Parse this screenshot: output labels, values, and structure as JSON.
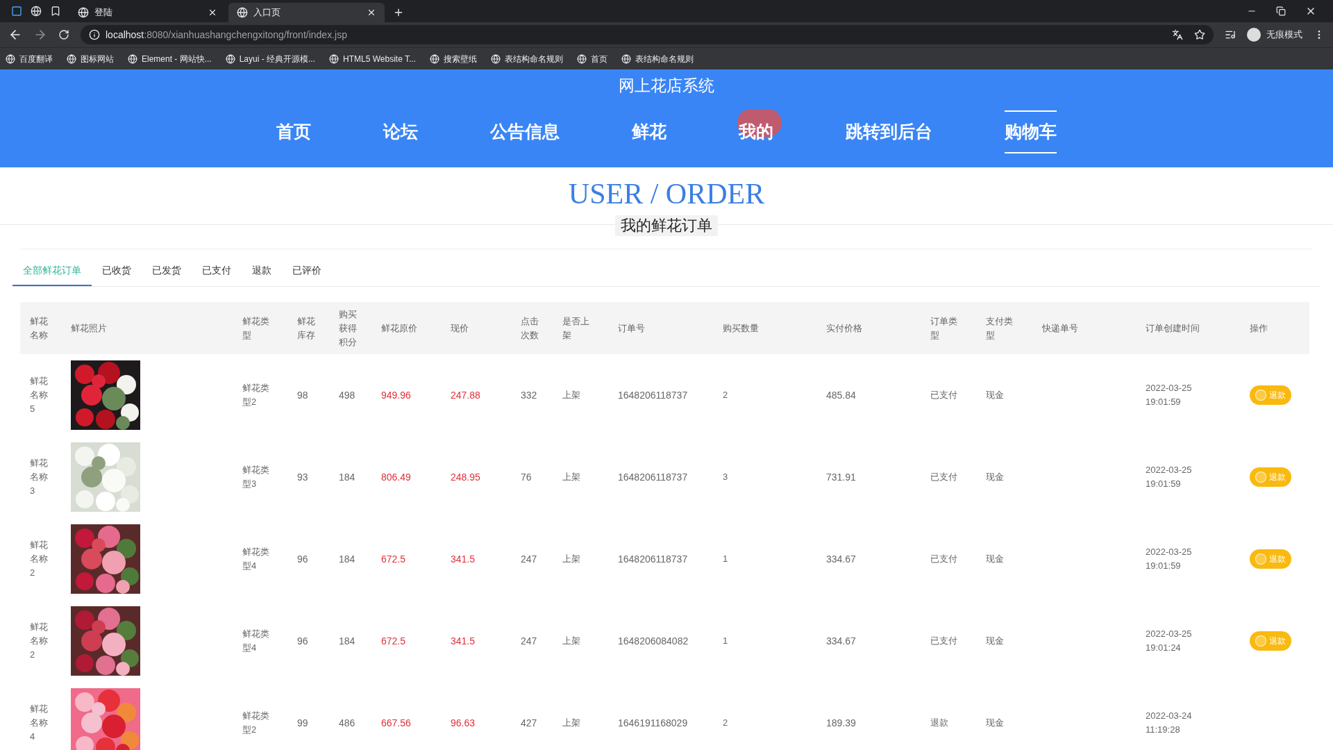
{
  "browser": {
    "tabs": [
      {
        "title": "登陆",
        "selected": false
      },
      {
        "title": "入口页",
        "selected": true
      }
    ],
    "url_host": "localhost",
    "url_path": ":8080/xianhuashangchengxitong/front/index.jsp",
    "profile": "无痕模式",
    "bookmarks": [
      "百度翻译",
      "图标网站",
      "Element - 网站快...",
      "Layui - 经典开源模...",
      "HTML5 Website T...",
      "搜索壁纸",
      "表结构命名规则",
      "首页",
      "表结构命名规则"
    ]
  },
  "site": {
    "title": "网上花店系统",
    "nav": [
      {
        "label": "首页",
        "selected": false,
        "hovered": false
      },
      {
        "label": "论坛",
        "selected": false,
        "hovered": false
      },
      {
        "label": "公告信息",
        "selected": false,
        "hovered": false
      },
      {
        "label": "鲜花",
        "selected": false,
        "hovered": false
      },
      {
        "label": "我的",
        "selected": false,
        "hovered": true
      },
      {
        "label": "跳转到后台",
        "selected": false,
        "hovered": false
      },
      {
        "label": "购物车",
        "selected": true,
        "hovered": false
      }
    ]
  },
  "heading": "USER / ORDER",
  "subheading": "我的鲜花订单",
  "filter_tabs": [
    {
      "label": "全部鲜花订单",
      "selected": true
    },
    {
      "label": "已收货",
      "selected": false
    },
    {
      "label": "已发货",
      "selected": false
    },
    {
      "label": "已支付",
      "selected": false
    },
    {
      "label": "退款",
      "selected": false
    },
    {
      "label": "已评价",
      "selected": false
    }
  ],
  "table": {
    "columns": [
      "鲜花名称",
      "鲜花照片",
      "鲜花类型",
      "鲜花库存",
      "购买获得积分",
      "鲜花原价",
      "现价",
      "点击次数",
      "是否上架",
      "订单号",
      "购买数量",
      "实付价格",
      "订单类型",
      "支付类型",
      "快递单号",
      "订单创建时间",
      "操作"
    ],
    "rows": [
      {
        "name": "鲜花名称5",
        "type": "鲜花类型2",
        "stock": "98",
        "points": "498",
        "original_price": "949.96",
        "price": "247.88",
        "clicks": "332",
        "on_shelf": "上架",
        "order_no": "1648206118737",
        "quantity": "2",
        "paid": "485.84",
        "order_type": "已支付",
        "pay_type": "现金",
        "created": "2022-03-25 19:01:59",
        "action": "退款"
      },
      {
        "name": "鲜花名称3",
        "type": "鲜花类型3",
        "stock": "93",
        "points": "184",
        "original_price": "806.49",
        "price": "248.95",
        "clicks": "76",
        "on_shelf": "上架",
        "order_no": "1648206118737",
        "quantity": "3",
        "paid": "731.91",
        "order_type": "已支付",
        "pay_type": "现金",
        "created": "2022-03-25 19:01:59",
        "action": "退款"
      },
      {
        "name": "鲜花名称2",
        "type": "鲜花类型4",
        "stock": "96",
        "points": "184",
        "original_price": "672.5",
        "price": "341.5",
        "clicks": "247",
        "on_shelf": "上架",
        "order_no": "1648206118737",
        "quantity": "1",
        "paid": "334.67",
        "order_type": "已支付",
        "pay_type": "现金",
        "created": "2022-03-25 19:01:59",
        "action": "退款"
      },
      {
        "name": "鲜花名称2",
        "type": "鲜花类型4",
        "stock": "96",
        "points": "184",
        "original_price": "672.5",
        "price": "341.5",
        "clicks": "247",
        "on_shelf": "上架",
        "order_no": "1648206084082",
        "quantity": "1",
        "paid": "334.67",
        "order_type": "已支付",
        "pay_type": "现金",
        "created": "2022-03-25 19:01:24",
        "action": "退款"
      },
      {
        "name": "鲜花名称4",
        "type": "鲜花类型2",
        "stock": "99",
        "points": "486",
        "original_price": "667.56",
        "price": "96.63",
        "clicks": "427",
        "on_shelf": "上架",
        "order_no": "1646191168029",
        "quantity": "2",
        "paid": "189.39",
        "order_type": "退款",
        "pay_type": "现金",
        "created": "2022-03-24 11:19:28"
      }
    ]
  }
}
